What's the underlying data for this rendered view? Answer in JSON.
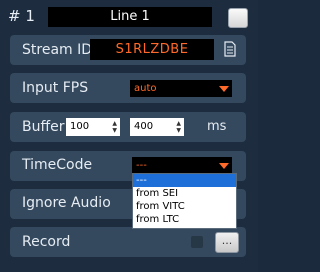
{
  "header": {
    "number": "# 1",
    "title": "Line 1"
  },
  "stream_id": {
    "label": "Stream ID",
    "value": "S1RLZDBE",
    "icon": "document-icon"
  },
  "input_fps": {
    "label": "Input FPS",
    "value": "auto"
  },
  "buffer": {
    "label": "Buffer",
    "min": "100",
    "max": "400",
    "unit": "ms"
  },
  "timecode": {
    "label": "TimeCode",
    "value": "---",
    "options": [
      "---",
      "from SEI",
      "from VITC",
      "from LTC"
    ]
  },
  "ignore_audio": {
    "label": "Ignore Audio"
  },
  "record": {
    "label": "Record",
    "button": "..."
  },
  "colors": {
    "panel": "#1d2c3f",
    "row": "#34495e",
    "accent": "#ff6a2a",
    "select_bg": "#000000",
    "highlight": "#1e6fd8"
  }
}
